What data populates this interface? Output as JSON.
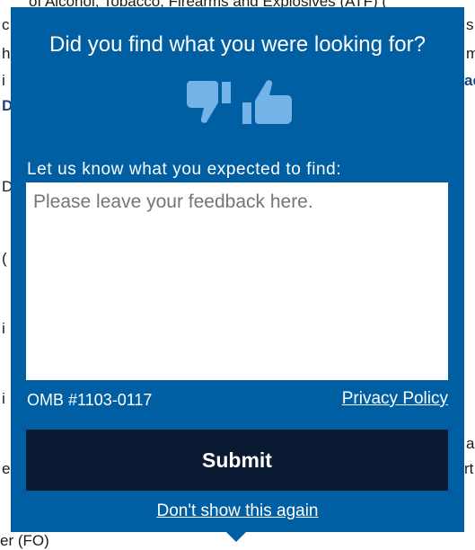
{
  "background": {
    "top_line": "of Alcohol, Tobacco, Firearms and Explosives (ATF) (",
    "left_chars": [
      "c",
      "h",
      "i",
      "D",
      "D",
      "(",
      "i",
      "i",
      "e",
      "e"
    ],
    "right_chars": [
      "s",
      "m",
      "ac",
      "a",
      "rt"
    ],
    "bottom_frag": "er (FO)"
  },
  "popup": {
    "question": "Did you find what you were looking for?",
    "prompt_label": "Let us know what you expected to find:",
    "feedback_placeholder": "Please leave your feedback here.",
    "feedback_value": "",
    "omb": "OMB #1103-0117",
    "privacy_link": "Privacy Policy",
    "submit_label": "Submit",
    "dont_show_link": "Don't show this again"
  },
  "colors": {
    "popup_bg": "#005ea2",
    "icon_color": "#73b3e7",
    "submit_bg": "#0b1a33",
    "text": "#ffffff"
  },
  "icons": [
    "thumbs-down-icon",
    "thumbs-up-icon"
  ]
}
